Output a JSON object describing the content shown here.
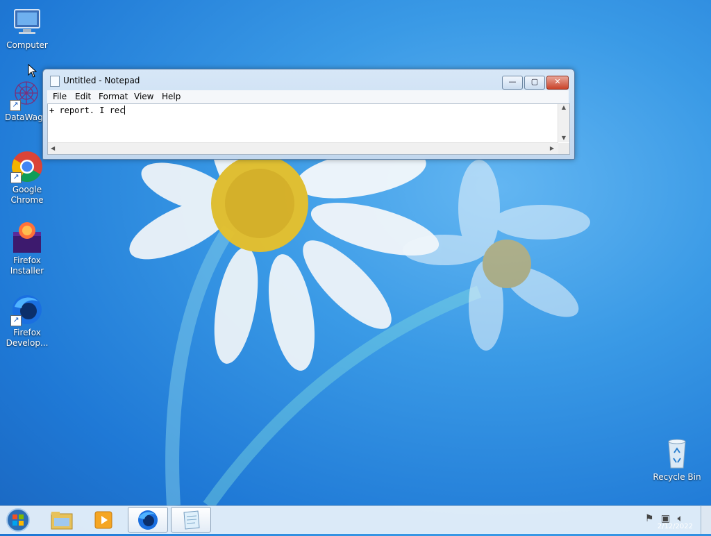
{
  "desktop": {
    "icons": [
      {
        "label": "Computer",
        "icon": "computer-icon"
      },
      {
        "label": "DataWago",
        "icon": "datawagon-icon"
      },
      {
        "label": "Google\nChrome",
        "icon": "chrome-icon"
      },
      {
        "label": "Firefox\nInstaller",
        "icon": "firefox-installer-icon"
      },
      {
        "label": "Firefox\nDevelop...",
        "icon": "firefox-developer-icon"
      },
      {
        "label": "Recycle Bin",
        "icon": "recycle-bin-icon"
      }
    ]
  },
  "notepad": {
    "title": "Untitled - Notepad",
    "buttons": {
      "minimize": "—",
      "maximize": "▢",
      "close": "✕"
    },
    "menu": [
      "File",
      "Edit",
      "Format",
      "View",
      "Help"
    ],
    "content": "+ report. I rec"
  },
  "taskbar": {
    "items": [
      "start-orb",
      "file-explorer",
      "media-player",
      "firefox",
      "notepad"
    ],
    "tray_icons": [
      "action-center-flag-icon",
      "network-icon",
      "volume-icon"
    ],
    "clock": "2/12/2022"
  },
  "colors": {
    "wallpaper": "#2a8ae0",
    "window_frame": "#c2d7ee",
    "close_button": "#c9432a"
  }
}
